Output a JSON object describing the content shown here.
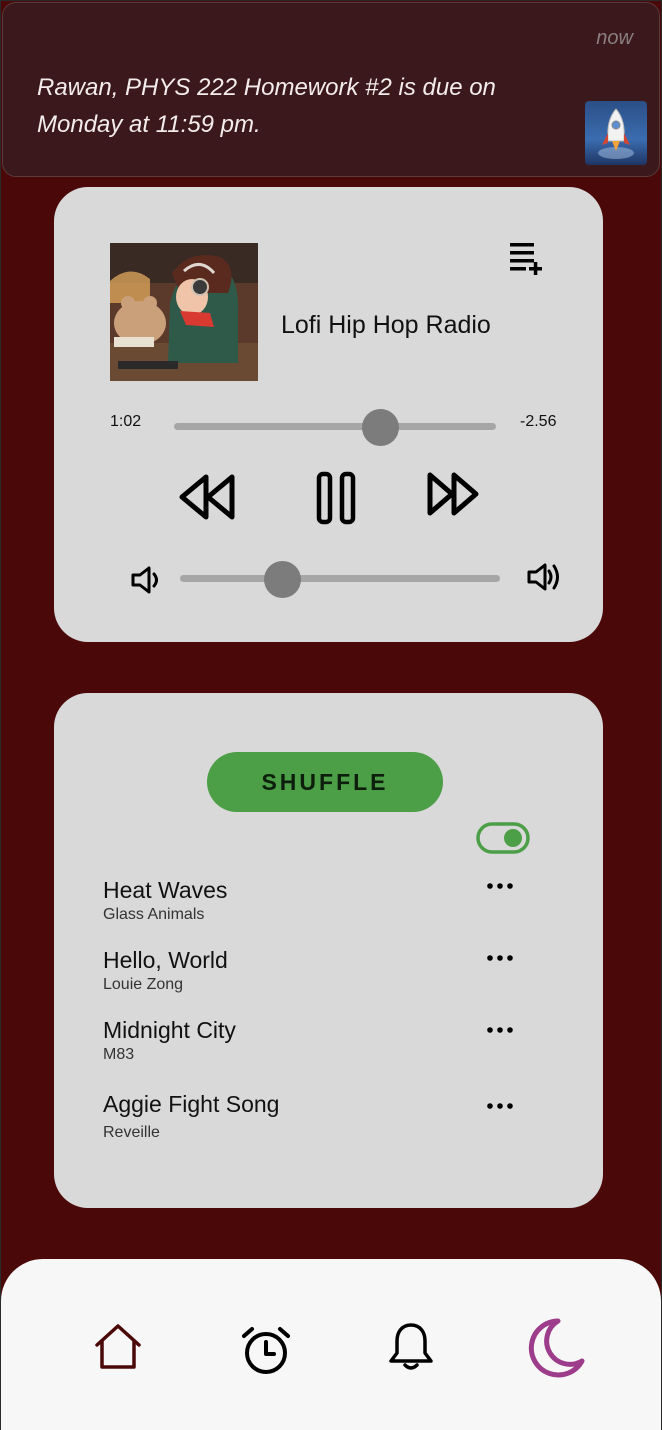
{
  "notification": {
    "time": "now",
    "message": "Rawan, PHYS 222 Homework #2 is due on Monday at 11:59 pm.",
    "app_icon": "rocket-icon"
  },
  "player": {
    "title": "Lofi Hip Hop Radio",
    "elapsed": "1:02",
    "remaining": "-2.56",
    "progress": 0.64,
    "volume": 0.32,
    "icons": {
      "queue": "playlist-add-icon",
      "rewind": "rewind-icon",
      "pause": "pause-icon",
      "forward": "fast-forward-icon",
      "vol_low": "volume-low-icon",
      "vol_high": "volume-high-icon"
    }
  },
  "playlist": {
    "shuffle_label": "SHUFFLE",
    "shuffle_on": true,
    "songs": [
      {
        "title": "Heat Waves",
        "artist": "Glass Animals"
      },
      {
        "title": "Hello, World",
        "artist": "Louie Zong"
      },
      {
        "title": "Midnight City",
        "artist": "M83"
      },
      {
        "title": "Aggie Fight Song",
        "artist": "Reveille"
      }
    ]
  },
  "nav": {
    "items": [
      {
        "icon": "home-icon",
        "color": "#4a0908"
      },
      {
        "icon": "alarm-clock-icon",
        "color": "#000000"
      },
      {
        "icon": "bell-icon",
        "color": "#000000"
      },
      {
        "icon": "moon-icon",
        "color": "#9c3c8a"
      }
    ]
  },
  "colors": {
    "background": "#4a0908",
    "card": "#d9d9d9",
    "accent_green": "#4c9e47",
    "moon": "#9c3c8a"
  }
}
